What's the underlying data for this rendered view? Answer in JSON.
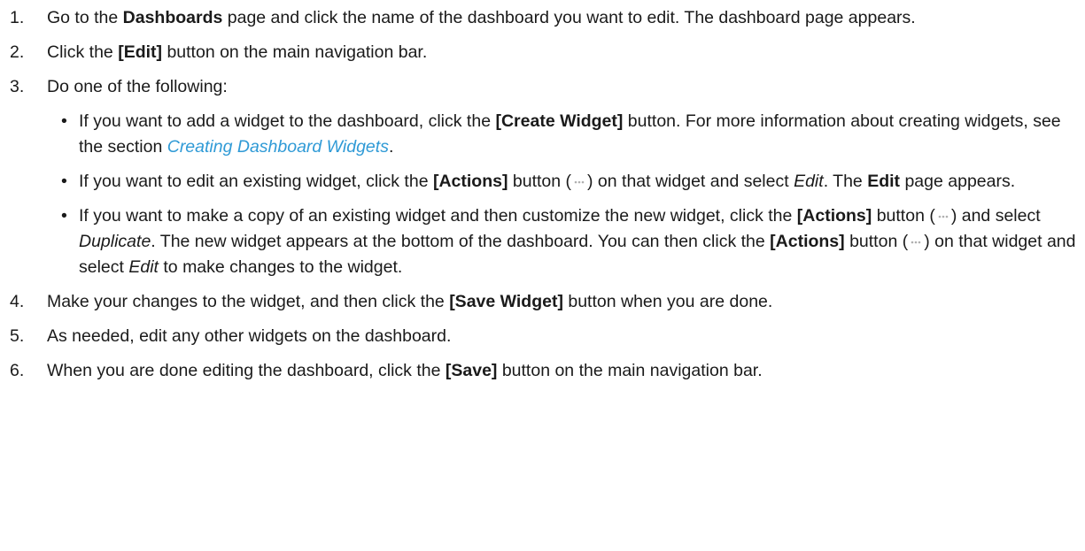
{
  "steps": [
    {
      "number": "1.",
      "t1": "Go to the ",
      "b1": "Dashboards",
      "t2": " page and click the name of the dashboard you want to edit. The dashboard page appears."
    },
    {
      "number": "2.",
      "t1": "Click the ",
      "b1": "[Edit]",
      "t2": " button on the main navigation bar."
    },
    {
      "number": "3.",
      "text": "Do one of the following:",
      "bullets": [
        {
          "t1": "If you want to add a widget to the dashboard, click the ",
          "b1": "[Create Widget]",
          "t2": " button. For more information about creating widgets, see the section ",
          "link": "Creating Dashboard Widgets",
          "t3": "."
        },
        {
          "t1": "If you want to edit an existing widget, click the ",
          "b1": "[Actions]",
          "t2": " button (",
          "t3": ") on that widget and select ",
          "i1": "Edit",
          "t4": ". The ",
          "b2": "Edit",
          "t5": " page appears."
        },
        {
          "t1": "If you want to make a copy of an existing widget and then customize the new widget, click the ",
          "b1": "[Actions]",
          "t2": " button (",
          "t3": ") and select ",
          "i1": "Duplicate",
          "t4": ". The new widget appears at the bottom of the dashboard. You can then click the ",
          "b2": "[Actions]",
          "t5": " button (",
          "t6": ") on that widget and select ",
          "i2": "Edit",
          "t7": " to make changes to the widget."
        }
      ]
    },
    {
      "number": "4.",
      "t1": "Make your changes to the widget, and then click the ",
      "b1": "[Save Widget]",
      "t2": " button when you are done."
    },
    {
      "number": "5.",
      "t1": "As needed, edit any other widgets on the dashboard."
    },
    {
      "number": "6.",
      "t1": "When you are done editing the dashboard, click the ",
      "b1": "[Save]",
      "t2": " button on the main navigation bar."
    }
  ],
  "bullet_glyph": "•",
  "icons": {
    "actions": "ellipsis-icon"
  },
  "colors": {
    "text": "#1a1a1a",
    "link": "#2f9ad6",
    "icon": "#b0b0b0"
  }
}
